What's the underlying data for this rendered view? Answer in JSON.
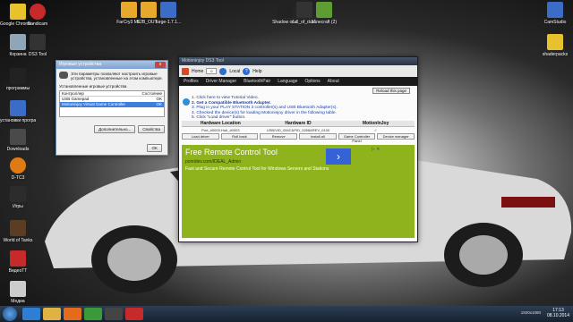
{
  "desktop": {
    "icons_left": [
      {
        "id": "chrome",
        "label": "Google Chrome - Ярлык",
        "color": "#e8c22c"
      },
      {
        "id": "bandicam",
        "label": "Bandicam",
        "color": "#c62a2a"
      },
      {
        "id": "recycle",
        "label": "Корзина",
        "color": "#8fa6b8"
      },
      {
        "id": "ds3tool",
        "label": "DS3 Tool",
        "color": "#333333"
      },
      {
        "id": "programs1",
        "label": "программы",
        "color": "#222222"
      },
      {
        "id": "programs2",
        "label": "установки программы",
        "color": "#3b6cc7"
      },
      {
        "id": "downloads",
        "label": "Downloads",
        "color": "#4a4a4a"
      },
      {
        "id": "d_tc",
        "label": "D-TC3",
        "color": "#e07a12"
      },
      {
        "id": "games",
        "label": "Игры",
        "color": "#2c2c2c"
      },
      {
        "id": "wot",
        "label": "World of Tanks",
        "color": "#5a3d22"
      },
      {
        "id": "fraps",
        "label": "ВидеоТТ",
        "color": "#c62a2a"
      },
      {
        "id": "media",
        "label": "Медиа",
        "color": "#cccccc"
      }
    ],
    "icons_top": [
      {
        "id": "farcry",
        "label": "FarCry3 Mi..",
        "color": "#e8a82c"
      },
      {
        "id": "b2b",
        "label": "B2B_OUT...",
        "color": "#e8a82c"
      },
      {
        "id": "forge",
        "label": "forge-1.7.1...",
        "color": "#3b6cc7"
      },
      {
        "id": "shadow",
        "label": "Shadow of...",
        "color": "#222222"
      },
      {
        "id": "call",
        "label": "call_of_dut...",
        "color": "#333333"
      },
      {
        "id": "minecraft",
        "label": "Minecraft (2)",
        "color": "#5c9e31"
      }
    ],
    "icons_right": [
      {
        "id": "camstudio",
        "label": "CamStudio",
        "color": "#3b6cc7"
      },
      {
        "id": "shaderpacks",
        "label": "shaderpacks",
        "color": "#e8c22c"
      }
    ]
  },
  "gc_dialog": {
    "title": "Игровые устройства",
    "close": "x",
    "description": "Эти параметры позволяют настроить игровые устройства, установленные на этом компьютере.",
    "list_label": "Установленные игровые устройства",
    "col_controller": "Контроллер",
    "col_status": "Состояние",
    "rows": [
      {
        "name": "USB Gamepad",
        "status": "OK"
      },
      {
        "name": "Motioninjoy Virtual Game Controller",
        "status": "OK"
      }
    ],
    "advanced": "Дополнительно...",
    "properties": "Свойства",
    "ok": "OK"
  },
  "mj_window": {
    "title": "Motioninjoy DS3 Tool",
    "toolbar": {
      "home": "Home",
      "page": "0",
      "local": "Local",
      "help": "Help"
    },
    "menu": [
      "Profiles",
      "Driver Manager",
      "BluetoothPair",
      "Language",
      "Options",
      "About"
    ],
    "reload": "Reload this page",
    "steps": [
      "1. Click here to view Tutorial Video.",
      "2. Get a Compatible Bluetooth Adapter.",
      "3. Plug in your PLAY STATION 3 controller(s) and USB Bluetooth Adapter(s).",
      "4. Checked the device(s) for loading Motioninjoy driver in the following table.",
      "5. Click \"Load driver\" button."
    ],
    "table_head": [
      "Hardware Location",
      "Hardware ID",
      "MotionInJoy"
    ],
    "table_row": [
      "Port_#0003.Hub_#0003",
      "USB\\VID_054C&PID_0268&REV_0100",
      "✓"
    ],
    "actions": [
      "Load driver",
      "Roll back",
      "Remove",
      "Install all",
      "Game Controller Panel",
      "Device manager"
    ],
    "ad": {
      "title": "Free Remote Control Tool",
      "url": "pointdev.com/IDEAL_Admin",
      "desc": "Fast and Secure Remote Control Tool for Windows Servers and Stations",
      "go": "›",
      "adchoices": "▷ ✕"
    }
  },
  "taskbar": {
    "apps": [
      {
        "id": "ie",
        "color": "#2e7fd4"
      },
      {
        "id": "explorer",
        "color": "#e0b243"
      },
      {
        "id": "media",
        "color": "#e46b1c"
      },
      {
        "id": "chrome",
        "color": "#3a9a3a"
      },
      {
        "id": "ds3",
        "color": "#444444"
      },
      {
        "id": "bandicam",
        "color": "#c62a2a"
      }
    ],
    "tray_text": "1920x1080",
    "time": "17:13",
    "date": "08.10.2014"
  }
}
